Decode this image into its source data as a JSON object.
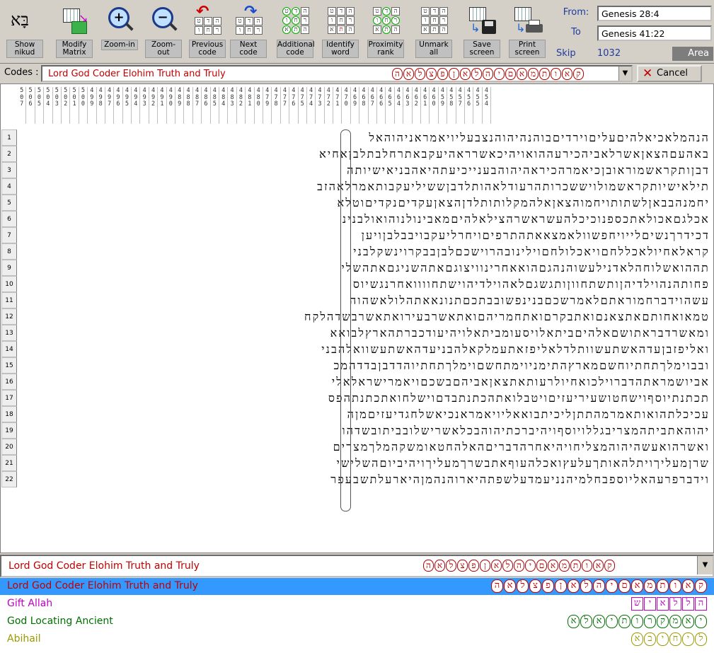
{
  "toolbar": {
    "buttons": [
      {
        "label": "Show nikud",
        "icon": "nikud-icon"
      },
      {
        "label": "Modify Matrix",
        "icon": "matrix-icon"
      },
      {
        "label": "Zoom-in",
        "icon": "zoom-in-icon"
      },
      {
        "label": "Zoom-out",
        "icon": "zoom-out-icon"
      },
      {
        "label": "Previous code",
        "icon": "previous-icon"
      },
      {
        "label": "Next code",
        "icon": "next-icon"
      },
      {
        "label": "Additional code",
        "icon": "additional-icon"
      },
      {
        "label": "Identify word",
        "icon": "identify-icon"
      },
      {
        "label": "Proximity rank",
        "icon": "proximity-icon"
      },
      {
        "label": "Unmark all",
        "icon": "unmark-icon"
      },
      {
        "label": "Save screen",
        "icon": "save-icon"
      },
      {
        "label": "Print screen",
        "icon": "print-icon"
      }
    ],
    "nikud_glyph": "בָּא",
    "grid_glyphs": [
      "ט",
      "ד",
      "ה",
      "ו",
      "ח",
      "ר",
      "א",
      "ת",
      "ה"
    ]
  },
  "range": {
    "from_label": "From:",
    "from_value": "Genesis 28:4",
    "to_label": "To",
    "to_value": "Genesis 41:22",
    "skip_label": "Skip",
    "skip_value": "1032",
    "area_label": "Area"
  },
  "codes": {
    "label": "Codes :",
    "current": "Lord God Coder Elohim Truth and Truly",
    "letters": [
      "ה",
      "א",
      "ל",
      "צ",
      "פ",
      "ן",
      "א",
      "ל",
      "ה",
      "י",
      "ם",
      "א",
      "מ",
      "ת",
      "ו",
      "א",
      "ק"
    ],
    "cancel_label": "Cancel",
    "dropdown_glyph": "▼"
  },
  "matrix": {
    "columns": [
      "507",
      "506",
      "505",
      "504",
      "503",
      "502",
      "501",
      "500",
      "499",
      "498",
      "497",
      "496",
      "495",
      "494",
      "493",
      "492",
      "491",
      "490",
      "489",
      "488",
      "487",
      "486",
      "485",
      "484",
      "483",
      "482",
      "481",
      "480",
      "479",
      "478",
      "477",
      "476",
      "475",
      "474",
      "473",
      "472",
      "471",
      "470",
      "469",
      "468",
      "467",
      "466",
      "465",
      "464",
      "463",
      "462",
      "461",
      "460",
      "459",
      "458",
      "457",
      "456",
      "455",
      "454"
    ],
    "rows": [
      "הנהמלאכיאלהיםעליםוירדיםבוהנהיהוהנצבעליויאמראניהוהאל",
      "באהעםהצאןאשרלאביהכירעההואויהיכאשרראהיעקבאתרחלבתלבןאחיא",
      "דבןותקראשמוראובןכיאמרהכיראהיהוהבענייכיעתהיאהבניאישיותה",
      "תילאישיותקראשמולויששכרותהרעודלאהותלדבןששיליעקבותאמרלאהזב",
      "יחמנהבבאןלשתותויחמוהצאןאלהמקלותותלדןהצאןעקדיםנקדיםוטלא",
      "אכלגםאכולאתכספנוכיכלהעשראשרהצילאלהיםמאבינולנוהואולבנינ",
      "דכידרךנשיםלייויחפשוולאמצאאתהתרפיםויחרליעקבויבבלבןויען",
      "קראלאחיולאכללחםויאכלולחםוילינובהרוישכםלבןבבקרוינשקלבני",
      "תההואשלוחהלאדנילעשוהנהגםהואאחרינוויצוגםאתהשניגםאתהשלי",
      "פחותהנהוילדיהןותשתחווןותגשגםלאהוילדיהוישתחוווואחרנגשיוס",
      "עשהוידברחמוראתםלאמרשכםבנינפשובבתכםתנונאאתהלולאשהוה",
      "טמאואחותםאתצאנםואתבקרםואתחמריהםואתאשרבעירואתאשרבשדהלקח",
      "ומאשרדבראתושםאלהיםביתאלויסעומביתאלויהיעודכברתהארץלבואא",
      "ואליפזבןעדהאשתעשוותלדלאליפזאתעמלקאלהבניעדהאשתעשוואלהבני",
      "ובבוימלךתחתיוחשםמארץהתימניוימתחשםוימלךתחתיוהדדבןבדדהמכ",
      "אביושמראתהדברוילכואחיולרעותאתצאןאביהםבשכםויאמרישראלאלי",
      "תכתנתיוסףוישחטושעיריעזיםויטבלואתהכתנתבדםוישלחואתכתנתהפס",
      "עכיכלתהואותאמרמהתתןליכיתבואאליויאמראנכיאשלחגדיעזיםמןה",
      "יהוהאתביתהמצריבגללויוסףויהיברכתיהוהבכלאשרישלובביתובשדהו",
      "ואשרהואעשהיהוהמצליחויהיאחרהדבריםהאלהחטאומשקהמלךמצרים",
      "שרןמעליךויתלהאותךעלעץואכלהעוףאתבשרךמעליךויהיביוםהשלישי",
      "וידברפרעהאליוספבחלמיהנניעמדעלשפתהיארוהנהמןהיארעלתשבעפר"
    ]
  },
  "bottom": {
    "combo_text": "Lord God Coder Elohim Truth and Truly",
    "dropdown_glyph": "▼",
    "entries": [
      {
        "name": "Lord God Coder Elohim Truth and Truly",
        "letters": [
          "ה",
          "א",
          "ל",
          "צ",
          "פ",
          "ן",
          "א",
          "ל",
          "ה",
          "י",
          "ם",
          "א",
          "מ",
          "ת",
          "ו",
          "א",
          "ק"
        ],
        "color": "#c00000"
      },
      {
        "name": "Gift Allah",
        "letters": [
          "ש",
          "י",
          "א",
          "ל",
          "ל",
          "ה"
        ],
        "color": "#c000c0"
      },
      {
        "name": "God Locating Ancient",
        "letters": [
          "א",
          "ל",
          "א",
          "י",
          "ת",
          "ו",
          "ר",
          "ק",
          "מ",
          "א",
          "י"
        ],
        "color": "#007000"
      },
      {
        "name": "Abihail",
        "letters": [
          "א",
          "ב",
          "י",
          "ח",
          "י",
          "ל"
        ],
        "color": "#9a9a00"
      }
    ]
  }
}
